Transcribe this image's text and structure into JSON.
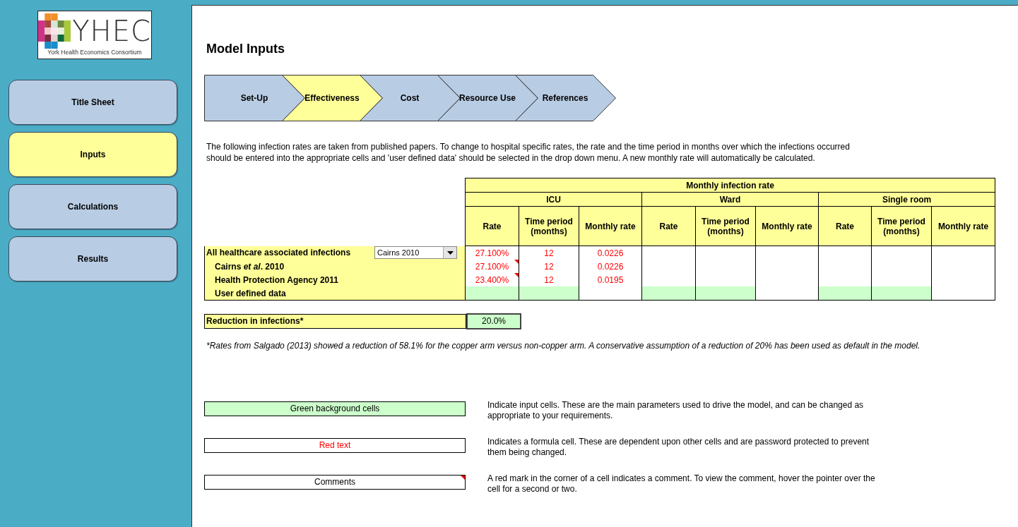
{
  "logo": {
    "name": "YHEC",
    "subtitle": "York Health Economics Consortium"
  },
  "nav": [
    {
      "label": "Title Sheet",
      "selected": false
    },
    {
      "label": "Inputs",
      "selected": true
    },
    {
      "label": "Calculations",
      "selected": false
    },
    {
      "label": "Results",
      "selected": false
    }
  ],
  "title": "Model Inputs",
  "steps": [
    {
      "label": "Set-Up",
      "selected": false
    },
    {
      "label": "Effectiveness",
      "selected": true
    },
    {
      "label": "Cost",
      "selected": false
    },
    {
      "label": "Resource Use",
      "selected": false
    },
    {
      "label": "References",
      "selected": false
    }
  ],
  "intro": "The following infection rates are taken from published papers. To change to hospital specific rates, the rate and the time period in months over which the infections occurred should be entered into the appropriate cells and 'user defined data' should be selected in the drop down menu. A new monthly rate will automatically be calculated.",
  "table": {
    "title": "Monthly infection rate",
    "groups": [
      {
        "name": "ICU",
        "columns": [
          "Rate",
          "Time period (months)",
          "Monthly rate"
        ]
      },
      {
        "name": "Ward",
        "columns": [
          "Rate",
          "Time period (months)",
          "Monthly rate"
        ]
      },
      {
        "name": "Single room",
        "columns": [
          "Rate",
          "Time period (months)",
          "Monthly rate"
        ]
      }
    ],
    "rows": [
      {
        "label": "All healthcare associated infections",
        "kind": "heading",
        "dropdown": "Cairns 2010",
        "cells": [
          {
            "kind": "formula",
            "text": "27.100%",
            "comment": false
          },
          {
            "kind": "formula",
            "text": "12",
            "comment": false
          },
          {
            "kind": "formula",
            "text": "0.0226",
            "comment": false
          },
          {
            "kind": "blank",
            "comment": false
          },
          {
            "kind": "blank",
            "comment": false
          },
          {
            "kind": "blank",
            "comment": false
          },
          {
            "kind": "blank",
            "comment": false
          },
          {
            "kind": "blank",
            "comment": false
          },
          {
            "kind": "blank",
            "comment": false
          }
        ]
      },
      {
        "label": "Cairns *et al*. 2010",
        "kind": "source",
        "cells": [
          {
            "kind": "formula",
            "text": "27.100%",
            "comment": true
          },
          {
            "kind": "formula",
            "text": "12",
            "comment": false
          },
          {
            "kind": "formula",
            "text": "0.0226",
            "comment": false
          },
          {
            "kind": "blank",
            "comment": false
          },
          {
            "kind": "blank",
            "comment": false
          },
          {
            "kind": "blank",
            "comment": false
          },
          {
            "kind": "blank",
            "comment": false
          },
          {
            "kind": "blank",
            "comment": false
          },
          {
            "kind": "blank",
            "comment": false
          }
        ]
      },
      {
        "label": "Health Protection Agency 2011",
        "kind": "source",
        "cells": [
          {
            "kind": "formula",
            "text": "23.400%",
            "comment": true
          },
          {
            "kind": "formula",
            "text": "12",
            "comment": false
          },
          {
            "kind": "formula",
            "text": "0.0195",
            "comment": false
          },
          {
            "kind": "blank",
            "comment": false
          },
          {
            "kind": "blank",
            "comment": false
          },
          {
            "kind": "blank",
            "comment": false
          },
          {
            "kind": "blank",
            "comment": false
          },
          {
            "kind": "blank",
            "comment": false
          },
          {
            "kind": "blank",
            "comment": false
          }
        ]
      },
      {
        "label": "User defined data",
        "kind": "source",
        "cells": [
          {
            "kind": "input",
            "comment": false
          },
          {
            "kind": "input",
            "comment": false
          },
          {
            "kind": "blank",
            "comment": false
          },
          {
            "kind": "input",
            "comment": false
          },
          {
            "kind": "input",
            "comment": false
          },
          {
            "kind": "blank",
            "comment": false
          },
          {
            "kind": "input",
            "comment": false
          },
          {
            "kind": "input",
            "comment": false
          },
          {
            "kind": "blank",
            "comment": false
          }
        ]
      }
    ]
  },
  "reduction": {
    "label": "Reduction in infections*",
    "value": "20.0%"
  },
  "footnote": "*Rates from Salgado (2013) showed a reduction of 58.1% for the copper arm versus non-copper arm.  A conservative assumption of a reduction of 20% has been used as default in the model.",
  "legend": [
    {
      "kind": "input",
      "label": "Green background cells",
      "description": "Indicate input cells.  These are the main parameters  used to drive  the model, and can be changed as appropriate  to your requirements."
    },
    {
      "kind": "formula",
      "label": "Red text",
      "description": "Indicates a formula cell.  These are dependent  upon other cells and are password protected to prevent  them being changed."
    },
    {
      "kind": "comment",
      "label": "Comments",
      "description": "A red mark in the corner of a cell indicates a comment.  To view the comment, hover the pointer over the cell for a second or two."
    }
  ]
}
